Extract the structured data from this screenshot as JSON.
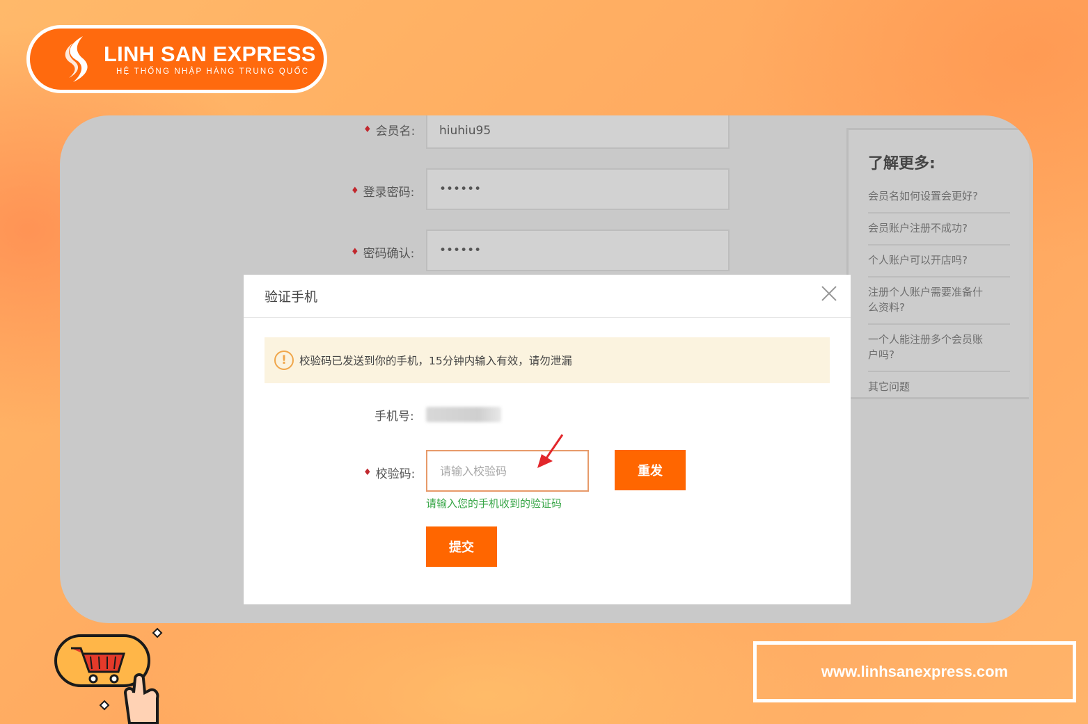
{
  "brand": {
    "name": "LINH SAN EXPRESS",
    "tagline": "HỆ THỐNG NHẬP HÀNG TRUNG QUỐC",
    "website": "www.linhsanexpress.com",
    "accent_color": "#ff6a0e"
  },
  "background_form": {
    "fields": [
      {
        "label": "会员名:",
        "value": "hiuhiu95"
      },
      {
        "label": "登录密码:",
        "value": "••••••"
      },
      {
        "label": "密码确认:",
        "value": "••••••"
      }
    ]
  },
  "side_panel": {
    "title": "了解更多:",
    "items": [
      "会员名如何设置会更好?",
      "会员账户注册不成功?",
      "个人账户可以开店吗?",
      "注册个人账户需要准备什么资料?",
      "一个人能注册多个会员账户吗?",
      "其它问题"
    ]
  },
  "modal": {
    "title": "验证手机",
    "notice": "校验码已发送到你的手机，15分钟内输入有效，请勿泄漏",
    "phone_label": "手机号:",
    "code_label": "校验码:",
    "code_placeholder": "请输入校验码",
    "code_hint": "请输入您的手机收到的验证码",
    "resend_label": "重发",
    "submit_label": "提交",
    "icons": {
      "close": "close-icon",
      "warning": "warning-icon"
    }
  },
  "colors": {
    "button": "#ff6600",
    "hint": "#35a545",
    "required_mark": "#c1272d"
  }
}
